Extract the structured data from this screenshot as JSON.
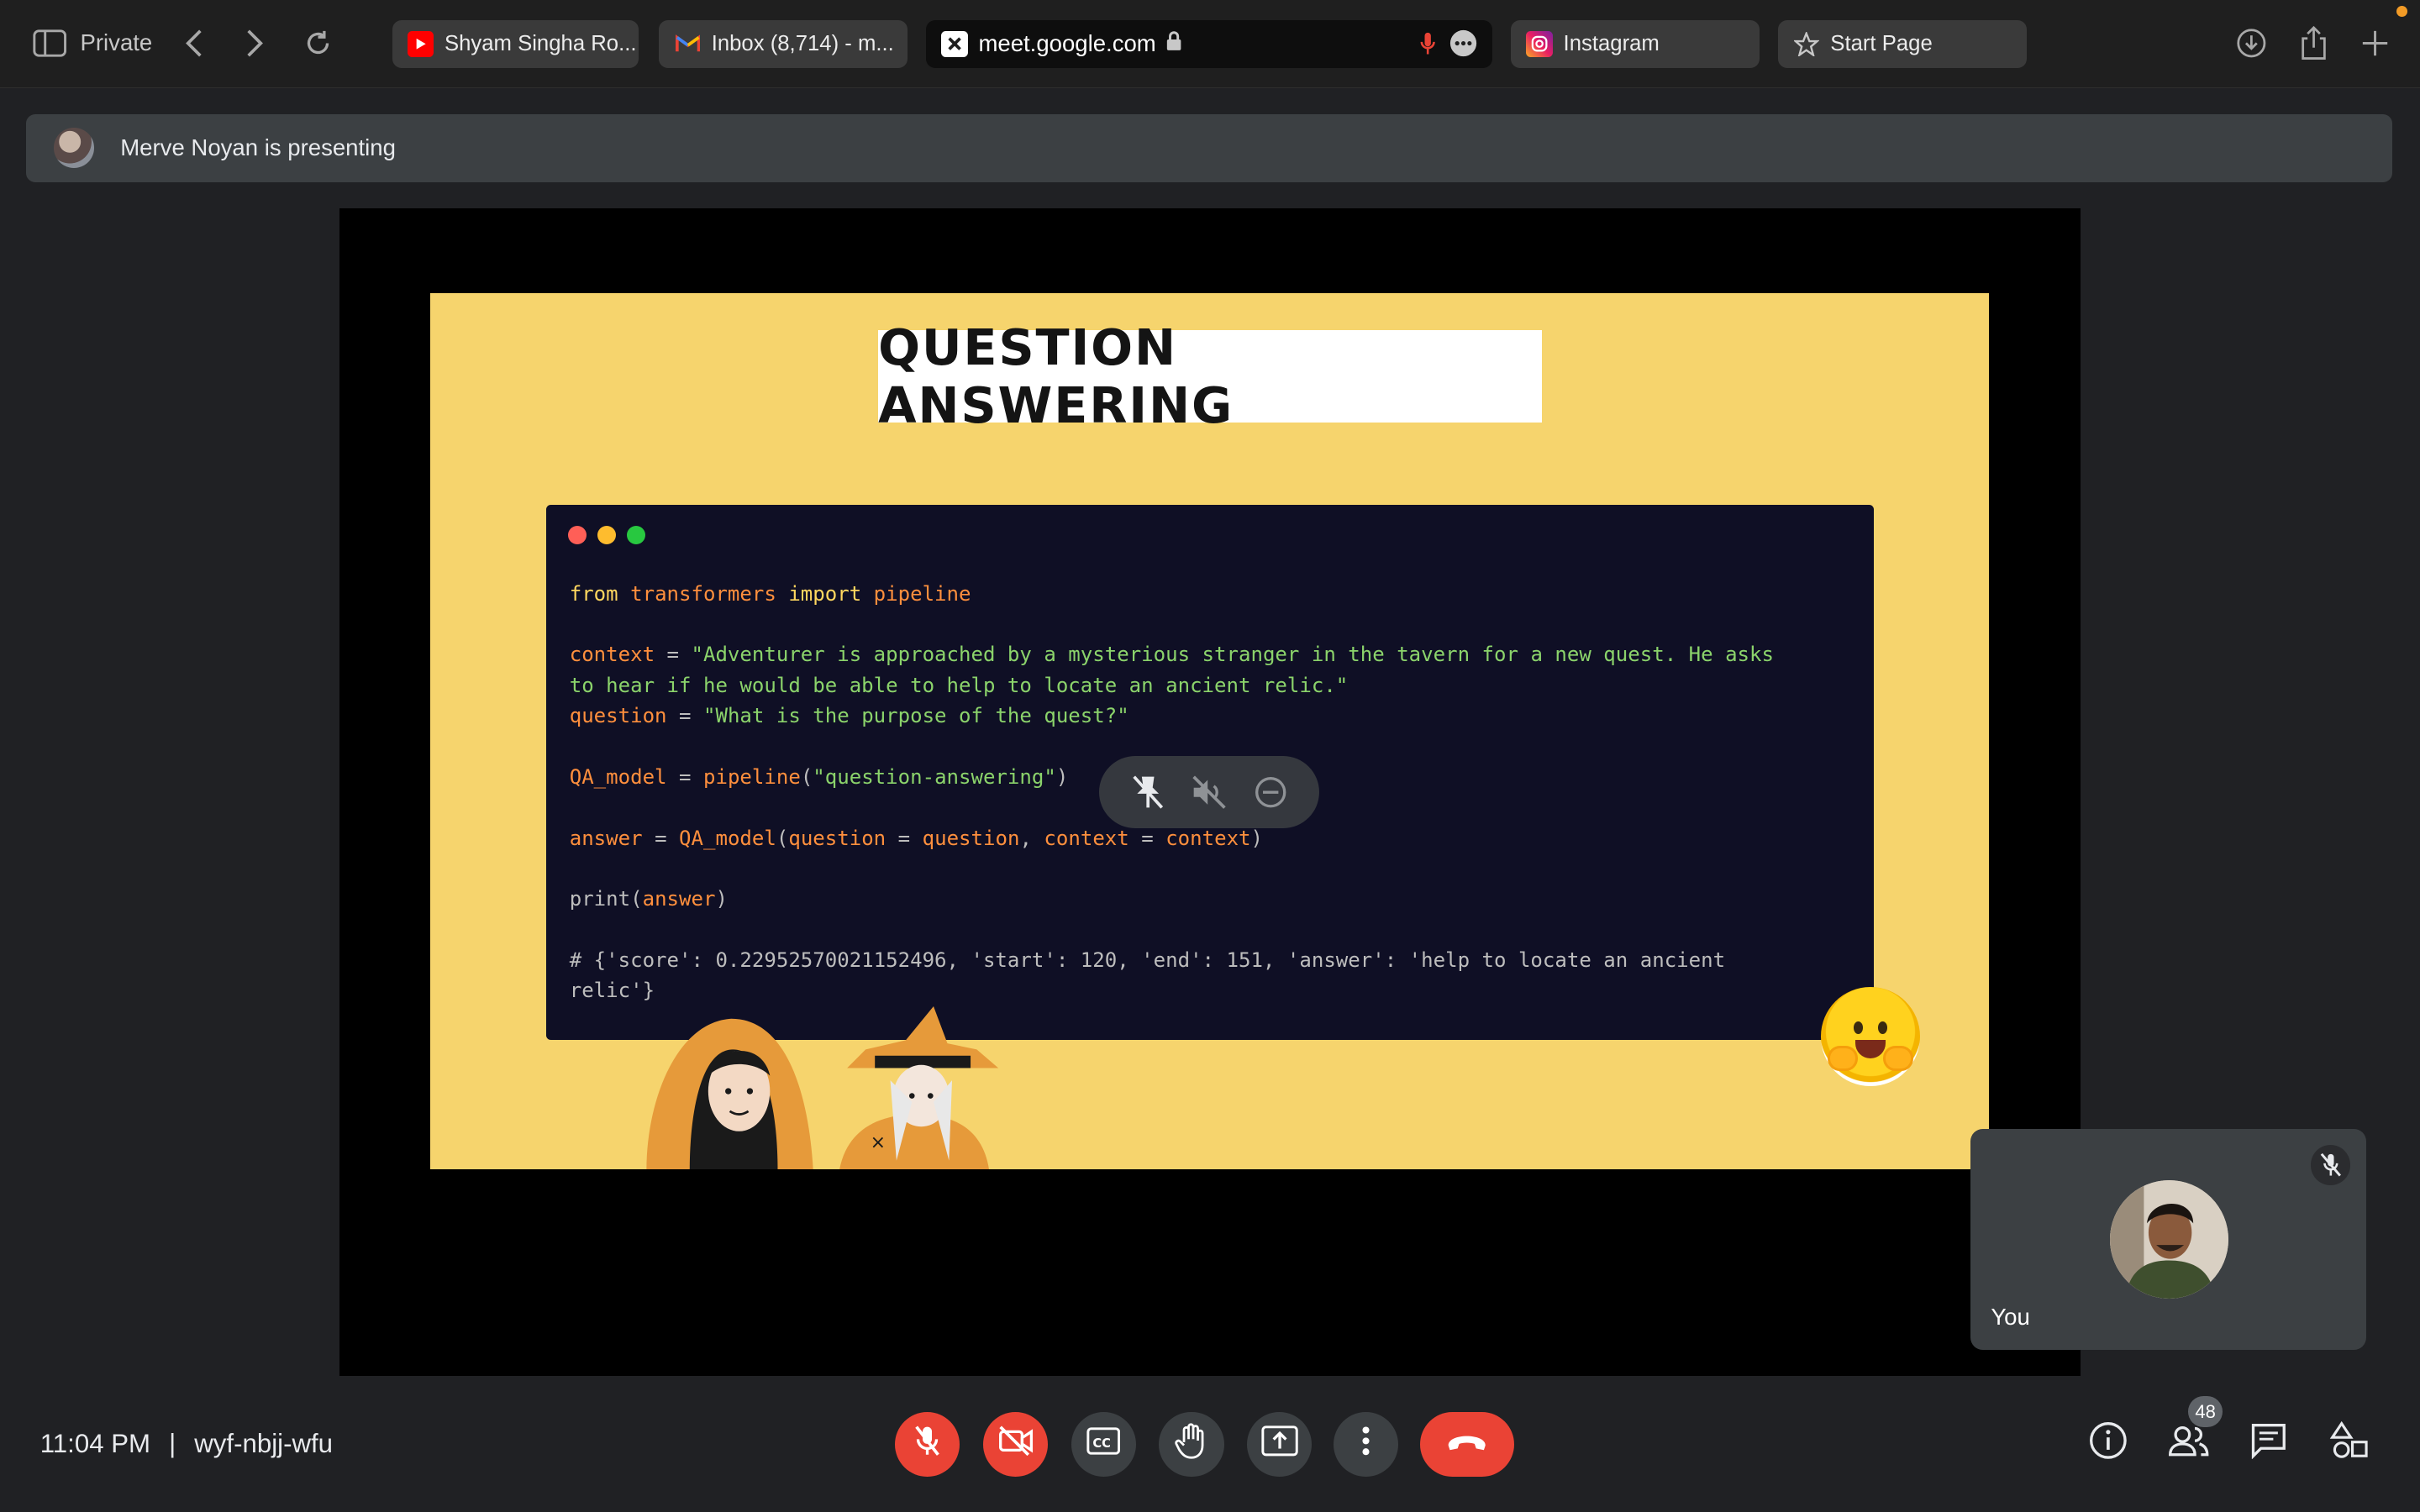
{
  "browser": {
    "private_label": "Private",
    "tabs": [
      {
        "label": "Shyam Singha Ro...",
        "favicon": "youtube-icon"
      },
      {
        "label": "Inbox (8,714) - m...",
        "favicon": "gmail-icon"
      },
      {
        "label": "meet.google.com",
        "favicon": "meet-icon",
        "active": true
      },
      {
        "label": "Instagram",
        "favicon": "instagram-icon"
      },
      {
        "label": "Start Page",
        "favicon": "star-icon"
      }
    ]
  },
  "meeting": {
    "presenting_text": "Merve Noyan is presenting",
    "time": "11:04 PM",
    "separator": "|",
    "meeting_code": "wyf-nbjj-wfu",
    "participant_count": "48",
    "self_name": "You"
  },
  "slide": {
    "title": "QUESTION ANSWERING",
    "code_lines": [
      [
        {
          "t": "from ",
          "c": "kw"
        },
        {
          "t": "transformers ",
          "c": "mod"
        },
        {
          "t": "import ",
          "c": "kw"
        },
        {
          "t": "pipeline",
          "c": "mod"
        }
      ],
      [],
      [
        {
          "t": "context",
          "c": "var"
        },
        {
          "t": " = ",
          "c": "fn"
        },
        {
          "t": "\"Adventurer is approached by a mysterious stranger in the tavern for a new quest. He asks",
          "c": "str"
        }
      ],
      [
        {
          "t": "to hear if he would be able to help to locate an ancient relic.\"",
          "c": "str"
        }
      ],
      [
        {
          "t": "question",
          "c": "var"
        },
        {
          "t": " = ",
          "c": "fn"
        },
        {
          "t": "\"What is the purpose of the quest?\"",
          "c": "str"
        }
      ],
      [],
      [
        {
          "t": "QA_model",
          "c": "var"
        },
        {
          "t": " = ",
          "c": "fn"
        },
        {
          "t": "pipeline",
          "c": "var"
        },
        {
          "t": "(",
          "c": "fn"
        },
        {
          "t": "\"question-answering\"",
          "c": "str"
        },
        {
          "t": ")",
          "c": "fn"
        }
      ],
      [],
      [
        {
          "t": "answer",
          "c": "var"
        },
        {
          "t": " = ",
          "c": "fn"
        },
        {
          "t": "QA_model",
          "c": "var"
        },
        {
          "t": "(",
          "c": "fn"
        },
        {
          "t": "question",
          "c": "var"
        },
        {
          "t": " = ",
          "c": "fn"
        },
        {
          "t": "question",
          "c": "var"
        },
        {
          "t": ", ",
          "c": "fn"
        },
        {
          "t": "context",
          "c": "var"
        },
        {
          "t": " = ",
          "c": "fn"
        },
        {
          "t": "context",
          "c": "var"
        },
        {
          "t": ")",
          "c": "fn"
        }
      ],
      [],
      [
        {
          "t": "print",
          "c": "fn"
        },
        {
          "t": "(",
          "c": "fn"
        },
        {
          "t": "answer",
          "c": "var"
        },
        {
          "t": ")",
          "c": "fn"
        }
      ],
      [],
      [
        {
          "t": "# {'score': 0.22952570021152496, 'start': 120, 'end': 151, 'answer': 'help to locate an ancient",
          "c": "cmt"
        }
      ],
      [
        {
          "t": "relic'}",
          "c": "cmt"
        }
      ]
    ]
  },
  "colors": {
    "slide_bg": "#f6d46d",
    "code_bg": "#0f0f25",
    "danger": "#ea4335",
    "control_gray": "#3c4043"
  }
}
